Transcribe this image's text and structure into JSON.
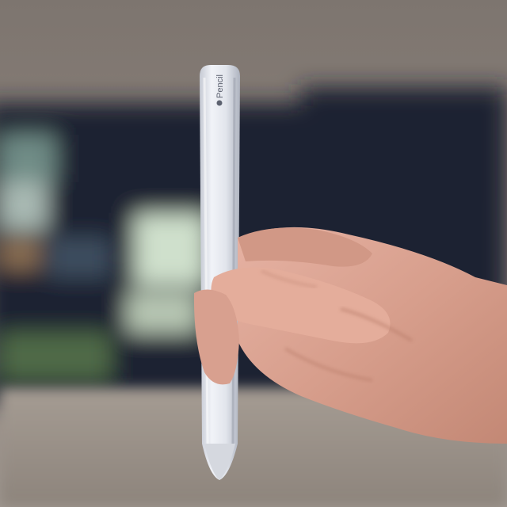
{
  "photo": {
    "subject": "stylus-held-in-hand",
    "stylus_logo": "Pencil",
    "colors": {
      "wall": "#8a7f77",
      "screen": "#1b2433",
      "stylus": "#e8eaf0",
      "skin": "#d9a291"
    }
  }
}
